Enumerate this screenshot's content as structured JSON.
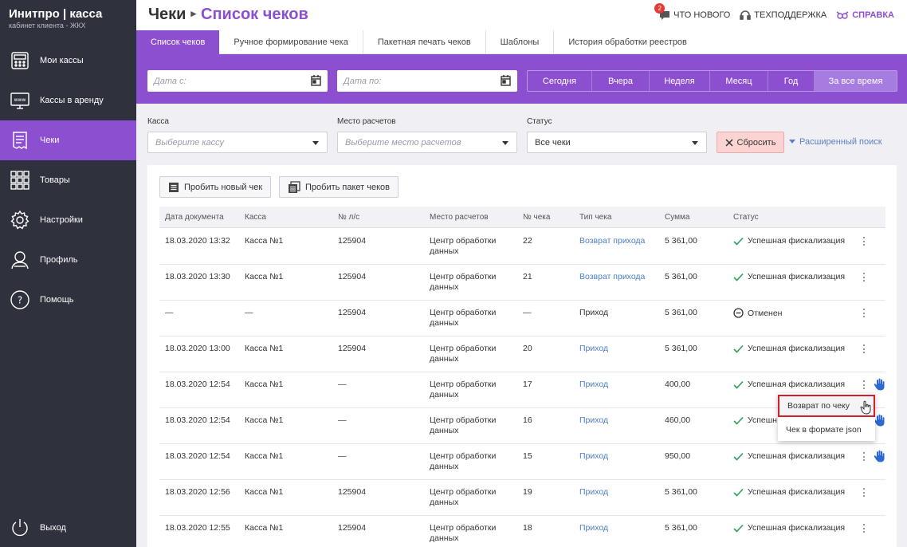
{
  "sidebar": {
    "logo_main": "Инитпро | касса",
    "logo_sub": "кабинет клиента - ЖКХ",
    "items": [
      {
        "label": "Мои кассы",
        "icon": "register-icon"
      },
      {
        "label": "Кассы в аренду",
        "icon": "www-monitor-icon"
      },
      {
        "label": "Чеки",
        "icon": "receipt-icon"
      },
      {
        "label": "Товары",
        "icon": "grid-icon"
      },
      {
        "label": "Настройки",
        "icon": "gear-icon"
      },
      {
        "label": "Профиль",
        "icon": "user-icon"
      },
      {
        "label": "Помощь",
        "icon": "help-icon"
      }
    ],
    "logout_label": "Выход"
  },
  "header": {
    "title": "Чеки",
    "subtitle": "Список чеков",
    "whats_new": "Что нового",
    "whats_new_badge": "2",
    "support": "Техподдержка",
    "help": "Справка"
  },
  "tabs": [
    "Список чеков",
    "Ручное формирование чека",
    "Пакетная печать чеков",
    "Шаблоны",
    "История обработки реестров"
  ],
  "date_filter": {
    "from_placeholder": "Дата с:",
    "to_placeholder": "Дата по:",
    "periods": [
      "Сегодня",
      "Вчера",
      "Неделя",
      "Месяц",
      "Год",
      "За все время"
    ],
    "active_period": "За все время"
  },
  "filters": {
    "kassa_label": "Касса",
    "kassa_placeholder": "Выберите кассу",
    "place_label": "Место расчетов",
    "place_placeholder": "Выберите место расчетов",
    "status_label": "Статус",
    "status_value": "Все чеки",
    "reset": "Сбросить",
    "advanced": "Расширенный поиск"
  },
  "actions": {
    "new_check": "Пробить новый чек",
    "batch_check": "Пробить пакет чеков"
  },
  "table": {
    "headers": [
      "Дата документа",
      "Касса",
      "№ л/с",
      "Место расчетов",
      "№ чека",
      "Тип чека",
      "Сумма",
      "Статус"
    ],
    "rows": [
      {
        "date": "18.03.2020 13:32",
        "kassa": "Касса №1",
        "account": "125904",
        "place": "Центр обработки данных",
        "num": "22",
        "type": "Возврат прихода",
        "type_link": true,
        "sum": "5 361,00",
        "status": "Успешная фискализация",
        "status_kind": "ok",
        "hand": false
      },
      {
        "date": "18.03.2020 13:30",
        "kassa": "Касса №1",
        "account": "125904",
        "place": "Центр обработки данных",
        "num": "21",
        "type": "Возврат прихода",
        "type_link": true,
        "sum": "5 361,00",
        "status": "Успешная фискализация",
        "status_kind": "ok",
        "hand": false
      },
      {
        "date": "—",
        "kassa": "—",
        "account": "125904",
        "place": "Центр обработки данных",
        "num": "—",
        "type": "Приход",
        "type_link": false,
        "sum": "5 361,00",
        "status": "Отменен",
        "status_kind": "cancel",
        "hand": false
      },
      {
        "date": "18.03.2020 13:00",
        "kassa": "Касса №1",
        "account": "125904",
        "place": "Центр обработки данных",
        "num": "20",
        "type": "Приход",
        "type_link": true,
        "sum": "5 361,00",
        "status": "Успешная фискализация",
        "status_kind": "ok",
        "hand": false
      },
      {
        "date": "18.03.2020 12:54",
        "kassa": "Касса №1",
        "account": "—",
        "place": "Центр обработки данных",
        "num": "17",
        "type": "Приход",
        "type_link": true,
        "sum": "400,00",
        "status": "Успешная фискализация",
        "status_kind": "ok",
        "hand": true
      },
      {
        "date": "18.03.2020 12:54",
        "kassa": "Касса №1",
        "account": "—",
        "place": "Центр обработки данных",
        "num": "16",
        "type": "Приход",
        "type_link": true,
        "sum": "460,00",
        "status": "Успешн",
        "status_kind": "ok",
        "hand": true
      },
      {
        "date": "18.03.2020 12:54",
        "kassa": "Касса №1",
        "account": "—",
        "place": "Центр обработки данных",
        "num": "15",
        "type": "Приход",
        "type_link": true,
        "sum": "950,00",
        "status": "Успешная фискализация",
        "status_kind": "ok",
        "hand": true
      },
      {
        "date": "18.03.2020 12:56",
        "kassa": "Касса №1",
        "account": "125904",
        "place": "Центр обработки данных",
        "num": "19",
        "type": "Приход",
        "type_link": true,
        "sum": "5 361,00",
        "status": "Успешная фискализация",
        "status_kind": "ok",
        "hand": false
      },
      {
        "date": "18.03.2020 12:55",
        "kassa": "Касса №1",
        "account": "125904",
        "place": "Центр обработки данных",
        "num": "18",
        "type": "Приход",
        "type_link": true,
        "sum": "5 361,00",
        "status": "Успешная фискализация",
        "status_kind": "ok",
        "hand": false
      }
    ]
  },
  "row_menu": {
    "items": [
      "Возврат по чеку",
      "Чек в формате json"
    ]
  },
  "colors": {
    "accent": "#8c4fd0",
    "sidebar": "#2f323c",
    "link": "#4c7fc8",
    "success": "#2e9e5b",
    "highlight_border": "#d0202a"
  }
}
